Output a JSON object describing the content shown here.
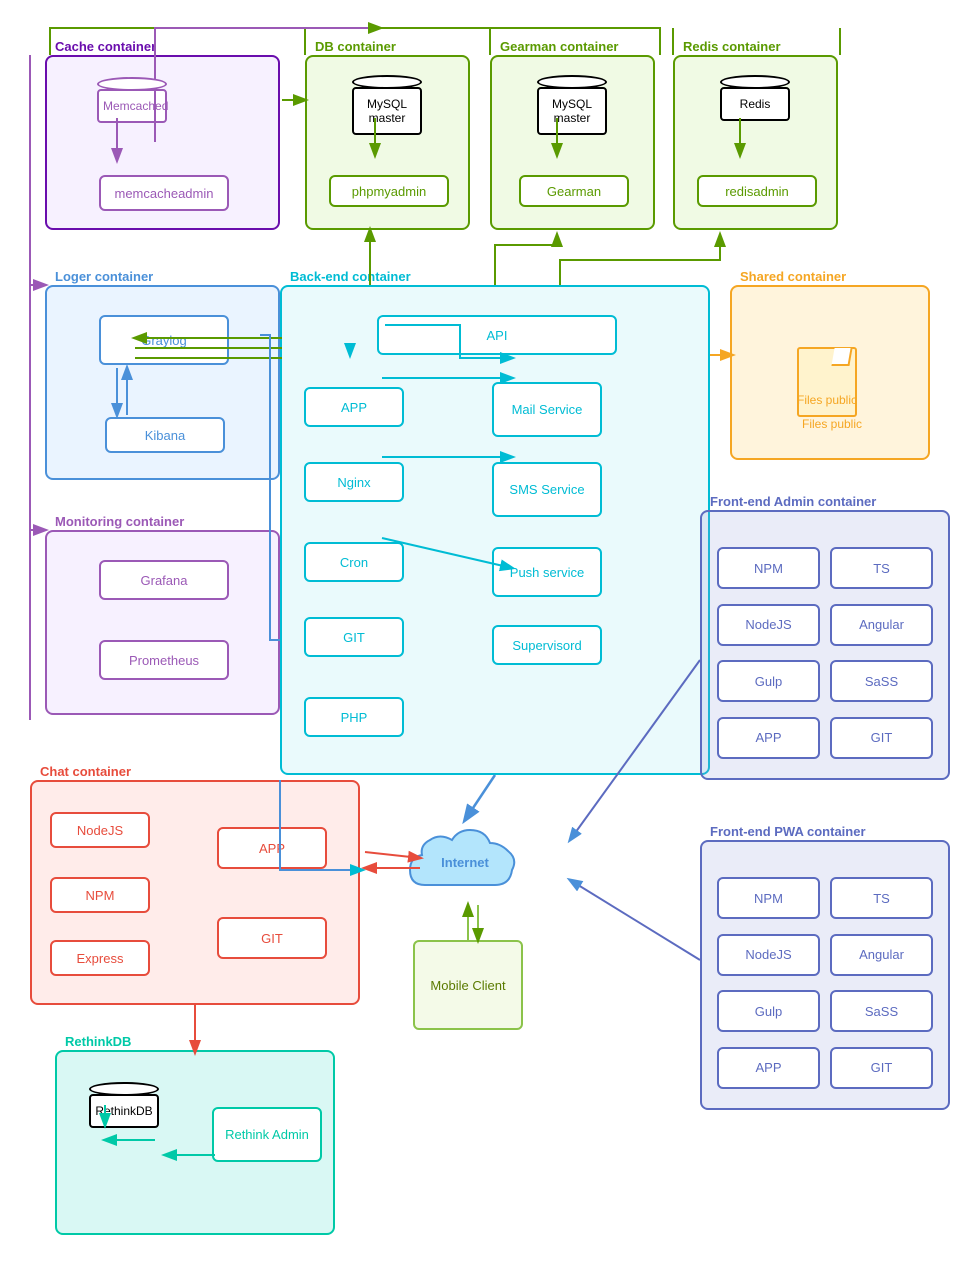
{
  "containers": {
    "cache": {
      "label": "Cache container"
    },
    "db": {
      "label": "DB container"
    },
    "gearman_container": {
      "label": "Gearman container"
    },
    "redis": {
      "label": "Redis container"
    },
    "logger": {
      "label": "Loger container"
    },
    "monitoring": {
      "label": "Monitoring container"
    },
    "backend": {
      "label": "Back-end container"
    },
    "shared": {
      "label": "Shared container"
    },
    "fe_admin": {
      "label": "Front-end Admin container"
    },
    "chat": {
      "label": "Chat container"
    },
    "fe_pwa": {
      "label": "Front-end PWA container"
    },
    "rethinkdb": {
      "label": "RethinkDB"
    }
  },
  "nodes": {
    "memcached": "Memcached",
    "memcacheadmin": "memcacheadmin",
    "mysql_master_db": "MySQL master",
    "phpmyadmin": "phpmyadmin",
    "mysql_master_gearman": "MySQL master",
    "gearman": "Gearman",
    "redis_node": "Redis",
    "redisadmin": "redisadmin",
    "graylog": "Graylog",
    "kibana": "Kibana",
    "grafana": "Grafana",
    "prometheus": "Prometheus",
    "api": "API",
    "app_backend": "APP",
    "mail_service": "Mail Service",
    "nginx": "Nginx",
    "sms_service": "SMS Service",
    "cron": "Cron",
    "push_service": "Push service",
    "git_backend": "GIT",
    "supervisord": "Supervisord",
    "php": "PHP",
    "files_public": "Files public",
    "fe_admin_npm": "NPM",
    "fe_admin_ts": "TS",
    "fe_admin_nodejs": "NodeJS",
    "fe_admin_angular": "Angular",
    "fe_admin_gulp": "Gulp",
    "fe_admin_sass": "SaSS",
    "fe_admin_app": "APP",
    "fe_admin_git": "GIT",
    "chat_nodejs": "NodeJS",
    "chat_npm": "NPM",
    "chat_express": "Express",
    "chat_app": "APP",
    "chat_git": "GIT",
    "internet": "Internet",
    "mobile_client": "Mobile Client",
    "fe_pwa_npm": "NPM",
    "fe_pwa_ts": "TS",
    "fe_pwa_nodejs": "NodeJS",
    "fe_pwa_angular": "Angular",
    "fe_pwa_gulp": "Gulp",
    "fe_pwa_sass": "SaSS",
    "fe_pwa_app": "APP",
    "fe_pwa_git": "GIT",
    "rethinkdb_node": "RethinkDB",
    "rethink_admin": "Rethink Admin"
  }
}
